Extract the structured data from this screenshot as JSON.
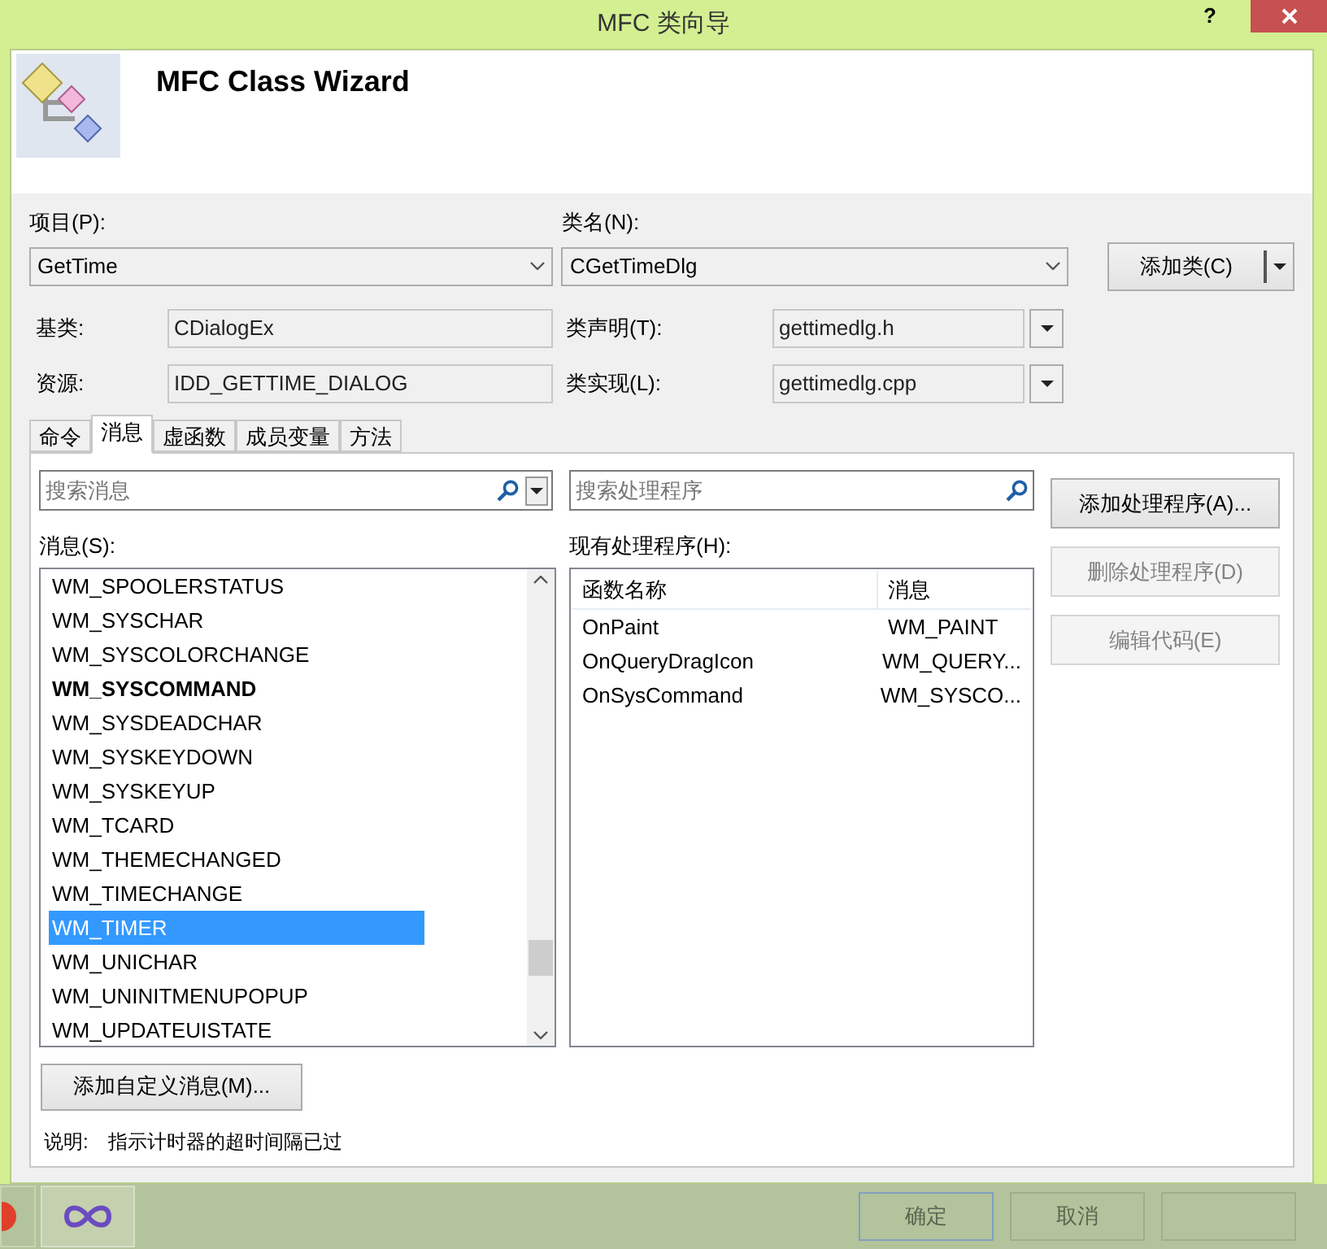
{
  "window": {
    "title": "MFC 类向导",
    "help": "?"
  },
  "header": {
    "title": "MFC Class Wizard"
  },
  "project": {
    "label": "项目(P):",
    "value": "GetTime"
  },
  "class_name": {
    "label": "类名(N):",
    "value": "CGetTimeDlg"
  },
  "add_class_button": {
    "label": "添加类(C)"
  },
  "base_class": {
    "label": "基类:",
    "value": "CDialogEx"
  },
  "resource": {
    "label": "资源:",
    "value": "IDD_GETTIME_DIALOG"
  },
  "class_declaration": {
    "label": "类声明(T):",
    "value": "gettimedlg.h"
  },
  "class_implementation": {
    "label": "类实现(L):",
    "value": "gettimedlg.cpp"
  },
  "tabs": [
    {
      "label": "命令",
      "selected": false
    },
    {
      "label": "消息",
      "selected": true
    },
    {
      "label": "虚函数",
      "selected": false
    },
    {
      "label": "成员变量",
      "selected": false
    },
    {
      "label": "方法",
      "selected": false
    }
  ],
  "message_search": {
    "placeholder": "搜索消息"
  },
  "handler_search": {
    "placeholder": "搜索处理程序"
  },
  "messages": {
    "label": "消息(S):",
    "items": [
      {
        "name": "WM_SPOOLERSTATUS",
        "bold": false,
        "selected": false
      },
      {
        "name": "WM_SYSCHAR",
        "bold": false,
        "selected": false
      },
      {
        "name": "WM_SYSCOLORCHANGE",
        "bold": false,
        "selected": false
      },
      {
        "name": "WM_SYSCOMMAND",
        "bold": true,
        "selected": false
      },
      {
        "name": "WM_SYSDEADCHAR",
        "bold": false,
        "selected": false
      },
      {
        "name": "WM_SYSKEYDOWN",
        "bold": false,
        "selected": false
      },
      {
        "name": "WM_SYSKEYUP",
        "bold": false,
        "selected": false
      },
      {
        "name": "WM_TCARD",
        "bold": false,
        "selected": false
      },
      {
        "name": "WM_THEMECHANGED",
        "bold": false,
        "selected": false
      },
      {
        "name": "WM_TIMECHANGE",
        "bold": false,
        "selected": false
      },
      {
        "name": "WM_TIMER",
        "bold": false,
        "selected": true
      },
      {
        "name": "WM_UNICHAR",
        "bold": false,
        "selected": false
      },
      {
        "name": "WM_UNINITMENUPOPUP",
        "bold": false,
        "selected": false
      },
      {
        "name": "WM_UPDATEUISTATE",
        "bold": false,
        "selected": false
      }
    ]
  },
  "handlers": {
    "label": "现有处理程序(H):",
    "columns": [
      "函数名称",
      "消息"
    ],
    "rows": [
      [
        "OnPaint",
        "WM_PAINT"
      ],
      [
        "OnQueryDragIcon",
        "WM_QUERY..."
      ],
      [
        "OnSysCommand",
        "WM_SYSCO..."
      ]
    ]
  },
  "handler_buttons": [
    {
      "label": "添加处理程序(A)...",
      "disabled": false
    },
    {
      "label": "删除处理程序(D)",
      "disabled": true
    },
    {
      "label": "编辑代码(E)",
      "disabled": true
    }
  ],
  "add_custom_message_button": {
    "label": "添加自定义消息(M)..."
  },
  "description": {
    "label": "说明:",
    "text": "指示计时器的超时间隔已过"
  },
  "dialog_buttons": [
    {
      "label": "确定"
    },
    {
      "label": "取消"
    }
  ]
}
